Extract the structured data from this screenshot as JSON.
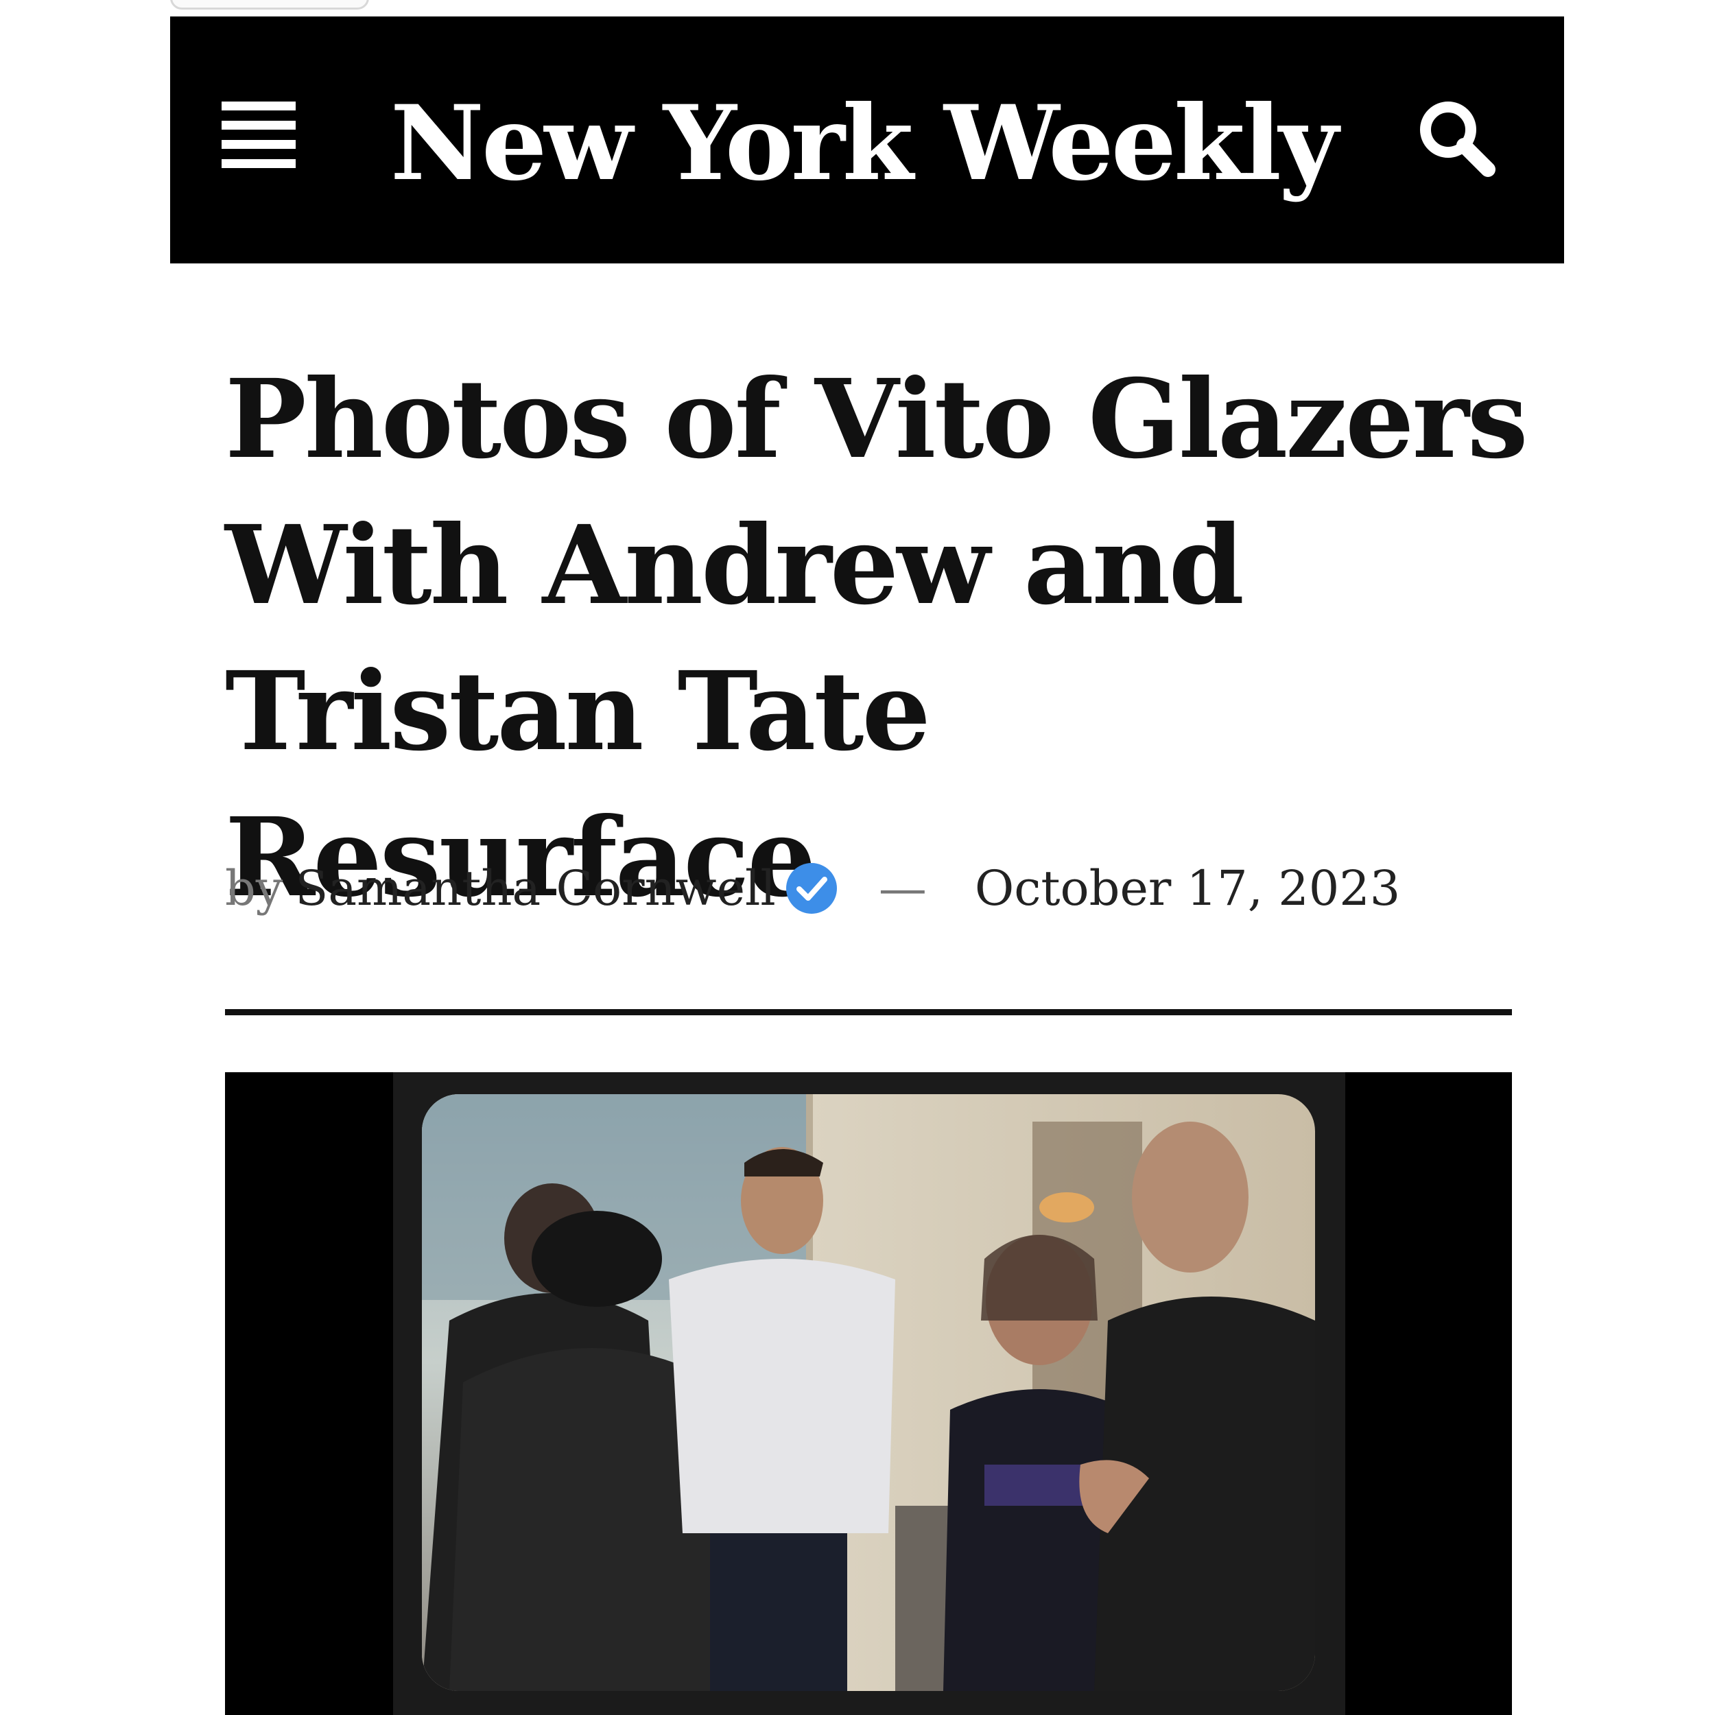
{
  "site": {
    "name": "New York Weekly",
    "colors": {
      "masthead_bg": "#000000",
      "masthead_text": "#ffffff",
      "headline_text": "#111111",
      "verified_badge": "#3d8ee8"
    },
    "icons": {
      "menu": "hamburger-menu-icon",
      "search": "magnifier-icon",
      "verified": "verified-check-badge-icon"
    }
  },
  "article": {
    "headline": "Photos of Vito Glazers With Andrew and Tristan Tate Resurface",
    "byline": {
      "prefix": "by",
      "author": "Samantha Cornwell",
      "separator": "—",
      "date": "October 17, 2023"
    }
  }
}
